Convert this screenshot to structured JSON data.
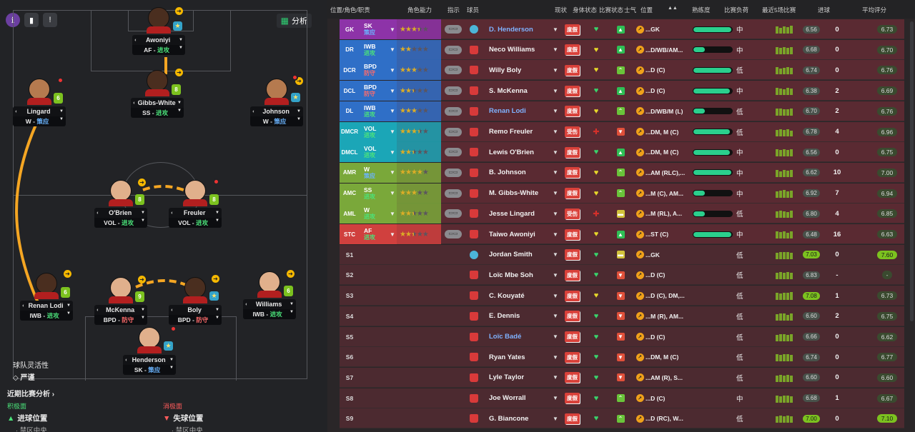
{
  "pitch": {
    "analyse_label": "分析",
    "team_mentality_label": "球队灵活性",
    "team_mentality_value": "严谨",
    "recent_analysis_label": "近期比赛分析 ›",
    "positive_title": "积极面",
    "positive_main": "进球位置",
    "positive_sub": "· 禁区中央",
    "negative_title": "消极面",
    "negative_main": "失球位置",
    "negative_sub": "· 禁区中央",
    "players": [
      {
        "name": "Awoniyi",
        "role": "AF",
        "duty": "进攻",
        "duty_type": "attack",
        "badge": "star",
        "badge_text": "★"
      },
      {
        "name": "Lingard",
        "role": "W",
        "duty": "策应",
        "duty_type": "support",
        "badge": "num",
        "badge_text": "6"
      },
      {
        "name": "Gibbs-White",
        "role": "SS",
        "duty": "进攻",
        "duty_type": "attack",
        "badge": "num",
        "badge_text": "8"
      },
      {
        "name": "Johnson",
        "role": "W",
        "duty": "策应",
        "duty_type": "support",
        "badge": "star",
        "badge_text": "★"
      },
      {
        "name": "O'Brien",
        "role": "VOL",
        "duty": "进攻",
        "duty_type": "attack",
        "badge": "num",
        "badge_text": "8"
      },
      {
        "name": "Freuler",
        "role": "VOL",
        "duty": "进攻",
        "duty_type": "attack",
        "badge": "num",
        "badge_text": "8"
      },
      {
        "name": "Renan Lodi",
        "role": "IWB",
        "duty": "进攻",
        "duty_type": "attack",
        "badge": "num",
        "badge_text": "6"
      },
      {
        "name": "McKenna",
        "role": "BPD",
        "duty": "防守",
        "duty_type": "defend",
        "badge": "num",
        "badge_text": "9"
      },
      {
        "name": "Boly",
        "role": "BPD",
        "duty": "防守",
        "duty_type": "defend",
        "badge": "star",
        "badge_text": "★"
      },
      {
        "name": "Williams",
        "role": "IWB",
        "duty": "进攻",
        "duty_type": "attack",
        "badge": "num",
        "badge_text": "6"
      },
      {
        "name": "Henderson",
        "role": "SK",
        "duty": "策应",
        "duty_type": "support",
        "badge": "star",
        "badge_text": "★"
      }
    ]
  },
  "table": {
    "headers": {
      "position_role": "位置/角色/职责",
      "role_ability": "角色能力",
      "instructions": "指示",
      "player": "球员",
      "status": "现状",
      "condition": "身体状态",
      "match_sharpness": "比赛状态",
      "morale": "士气",
      "position": "位置",
      "sort": "▲▲",
      "familiarity": "熟练度",
      "match_load": "比赛负荷",
      "last5": "最近5场比赛",
      "goals": "进球",
      "avg_rating": "平均评分"
    },
    "rows": [
      {
        "pos": "GK",
        "pos_color": "#8d33a8",
        "role": "SK",
        "duty": "策应",
        "duty_type": "support",
        "stars": 3.5,
        "gk": true,
        "name": "D. Henderson",
        "link": true,
        "status": "度假",
        "cond": "heart",
        "sharp": "up",
        "sharp_color": "#2fbf55",
        "position": "...GK",
        "fam": 0.98,
        "load": "中",
        "form": [
          10,
          8,
          10,
          9,
          11
        ],
        "avg": "6.56",
        "avg_hi": false,
        "goals": "0",
        "rating": "6.73",
        "rating_hi": false
      },
      {
        "pos": "DR",
        "pos_color": "#2f6fc7",
        "role": "IWB",
        "duty": "进攻",
        "duty_type": "attack",
        "stars": 2,
        "gk": false,
        "name": "Neco Williams",
        "link": false,
        "status": "度假",
        "cond": "yellow",
        "sharp": "up",
        "sharp_color": "#2fbf55",
        "position": "...D/WB/AM...",
        "fam": 0.3,
        "load": "中",
        "form": [
          10,
          9,
          10,
          9,
          10
        ],
        "avg": "6.68",
        "avg_hi": false,
        "goals": "0",
        "rating": "6.70",
        "rating_hi": false
      },
      {
        "pos": "DCR",
        "pos_color": "#2f6fc7",
        "role": "BPD",
        "duty": "防守",
        "duty_type": "defend",
        "stars": 3,
        "gk": false,
        "name": "Willy Boly",
        "link": false,
        "status": "度假",
        "cond": "yellow",
        "sharp": "up2",
        "sharp_color": "#6ac43a",
        "position": "...D (C)",
        "fam": 0.98,
        "load": "低",
        "form": [
          10,
          8,
          9,
          10,
          9
        ],
        "avg": "6.74",
        "avg_hi": false,
        "goals": "0",
        "rating": "6.76",
        "rating_hi": false
      },
      {
        "pos": "DCL",
        "pos_color": "#2f6fc7",
        "role": "BPD",
        "duty": "防守",
        "duty_type": "defend",
        "stars": 2.5,
        "gk": false,
        "name": "S. McKenna",
        "link": false,
        "status": "度假",
        "cond": "heart",
        "sharp": "up",
        "sharp_color": "#2fbf55",
        "position": "...D (C)",
        "fam": 0.95,
        "load": "中",
        "form": [
          10,
          9,
          8,
          10,
          9
        ],
        "avg": "6.38",
        "avg_hi": false,
        "goals": "2",
        "rating": "6.69",
        "rating_hi": false
      },
      {
        "pos": "DL",
        "pos_color": "#2f6fc7",
        "role": "IWB",
        "duty": "进攻",
        "duty_type": "attack",
        "stars": 3,
        "gk": false,
        "name": "Renan Lodi",
        "link": true,
        "status": "度假",
        "cond": "yellow",
        "sharp": "up2",
        "sharp_color": "#6ac43a",
        "position": "...D/WB/M (L)",
        "fam": 0.3,
        "load": "低",
        "form": [
          10,
          10,
          9,
          9,
          10
        ],
        "avg": "6.70",
        "avg_hi": false,
        "goals": "2",
        "rating": "6.76",
        "rating_hi": false
      },
      {
        "pos": "DMCR",
        "pos_color": "#1ba6b7",
        "role": "VOL",
        "duty": "进攻",
        "duty_type": "attack",
        "stars": 3.5,
        "gk": false,
        "name": "Remo Freuler",
        "link": false,
        "status": "受伤",
        "cond": "injury",
        "sharp": "down",
        "sharp_color": "#e0503a",
        "position": "...DM, M (C)",
        "fam": 0.95,
        "load": "低",
        "form": [
          9,
          10,
          9,
          10,
          8
        ],
        "avg": "6.78",
        "avg_hi": false,
        "goals": "4",
        "rating": "6.96",
        "rating_hi": false
      },
      {
        "pos": "DMCL",
        "pos_color": "#1ba6b7",
        "role": "VOL",
        "duty": "进攻",
        "duty_type": "attack",
        "stars": 2.5,
        "gk": false,
        "name": "Lewis O'Brien",
        "link": false,
        "status": "度假",
        "cond": "heart",
        "sharp": "up",
        "sharp_color": "#2fbf55",
        "position": "...DM, M (C)",
        "fam": 0.95,
        "load": "中",
        "form": [
          10,
          9,
          10,
          9,
          10
        ],
        "avg": "6.56",
        "avg_hi": false,
        "goals": "0",
        "rating": "6.75",
        "rating_hi": false
      },
      {
        "pos": "AMR",
        "pos_color": "#7aa83a",
        "role": "W",
        "duty": "策应",
        "duty_type": "support",
        "stars": 4,
        "gk": false,
        "name": "B. Johnson",
        "link": false,
        "status": "度假",
        "cond": "yellow",
        "sharp": "up2",
        "sharp_color": "#6ac43a",
        "position": "...AM (RLC),...",
        "fam": 0.98,
        "load": "中",
        "form": [
          10,
          8,
          10,
          9,
          10
        ],
        "avg": "6.62",
        "avg_hi": false,
        "goals": "10",
        "rating": "7.00",
        "rating_hi": false
      },
      {
        "pos": "AMC",
        "pos_color": "#7aa83a",
        "role": "SS",
        "duty": "进攻",
        "duty_type": "attack",
        "stars": 3,
        "gk": false,
        "name": "M. Gibbs-White",
        "link": false,
        "status": "度假",
        "cond": "yellow",
        "sharp": "up2",
        "sharp_color": "#6ac43a",
        "position": "...M (C), AM...",
        "fam": 0.3,
        "load": "中",
        "form": [
          9,
          10,
          11,
          9,
          10
        ],
        "avg": "6.92",
        "avg_hi": false,
        "goals": "7",
        "rating": "6.94",
        "rating_hi": false
      },
      {
        "pos": "AML",
        "pos_color": "#7aa83a",
        "role": "W",
        "duty": "进攻",
        "duty_type": "attack",
        "stars": 2.5,
        "gk": false,
        "name": "Jesse Lingard",
        "link": false,
        "status": "受伤",
        "cond": "injury",
        "sharp": "flat",
        "sharp_color": "#d2c23a",
        "position": "...M (RL), A...",
        "fam": 0.3,
        "load": "低",
        "form": [
          9,
          10,
          9,
          8,
          10
        ],
        "avg": "6.80",
        "avg_hi": false,
        "goals": "4",
        "rating": "6.85",
        "rating_hi": false
      },
      {
        "pos": "STC",
        "pos_color": "#d0403e",
        "role": "AF",
        "duty": "进攻",
        "duty_type": "attack",
        "stars": 2.5,
        "gk": false,
        "name": "Taiwo Awoniyi",
        "link": false,
        "status": "度假",
        "cond": "yellow",
        "sharp": "up",
        "sharp_color": "#2fbf55",
        "position": "...ST (C)",
        "fam": 0.98,
        "load": "中",
        "form": [
          10,
          9,
          10,
          8,
          10
        ],
        "avg": "6.48",
        "avg_hi": false,
        "goals": "16",
        "rating": "6.63",
        "rating_hi": false
      },
      {
        "pos": "S1",
        "role": "",
        "duty": "",
        "stars": 0,
        "gk": true,
        "name": "Jordan Smith",
        "link": false,
        "status": "度假",
        "cond": "heart",
        "sharp": "flat",
        "sharp_color": "#d2c23a",
        "position": "...GK",
        "fam": null,
        "load": "低",
        "form": [
          9,
          10,
          10,
          10,
          9
        ],
        "avg": "7.03",
        "avg_hi": true,
        "goals": "0",
        "rating": "7.60",
        "rating_hi": true
      },
      {
        "pos": "S2",
        "role": "",
        "duty": "",
        "stars": 0,
        "gk": false,
        "name": "Loïc Mbe Soh",
        "link": false,
        "status": "度假",
        "cond": "heart",
        "sharp": "down",
        "sharp_color": "#e0503a",
        "position": "...D (C)",
        "fam": null,
        "load": "低",
        "form": [
          9,
          10,
          9,
          10,
          9
        ],
        "avg": "6.83",
        "avg_hi": false,
        "goals": "-",
        "rating": "-",
        "rating_hi": false
      },
      {
        "pos": "S3",
        "role": "",
        "duty": "",
        "stars": 0,
        "gk": false,
        "name": "C. Kouyaté",
        "link": false,
        "status": "度假",
        "cond": "yellow",
        "sharp": "down",
        "sharp_color": "#e0503a",
        "position": "...D (C), DM,...",
        "fam": null,
        "load": "低",
        "form": [
          10,
          9,
          10,
          10,
          11
        ],
        "avg": "7.08",
        "avg_hi": true,
        "goals": "1",
        "rating": "6.73",
        "rating_hi": false
      },
      {
        "pos": "S4",
        "role": "",
        "duty": "",
        "stars": 0,
        "gk": false,
        "name": "E. Dennis",
        "link": false,
        "status": "度假",
        "cond": "heart",
        "sharp": "down",
        "sharp_color": "#e0503a",
        "position": "...M (R), AM...",
        "fam": null,
        "load": "低",
        "form": [
          9,
          10,
          10,
          8,
          10
        ],
        "avg": "6.60",
        "avg_hi": false,
        "goals": "2",
        "rating": "6.75",
        "rating_hi": false
      },
      {
        "pos": "S5",
        "role": "",
        "duty": "",
        "stars": 0,
        "gk": false,
        "name": "Loïc Badé",
        "link": true,
        "status": "度假",
        "cond": "heart",
        "sharp": "down",
        "sharp_color": "#e0503a",
        "position": "...D (C)",
        "fam": null,
        "load": "低",
        "form": [
          9,
          10,
          10,
          9,
          10
        ],
        "avg": "6.66",
        "avg_hi": false,
        "goals": "0",
        "rating": "6.62",
        "rating_hi": false
      },
      {
        "pos": "S6",
        "role": "",
        "duty": "",
        "stars": 0,
        "gk": false,
        "name": "Ryan Yates",
        "link": false,
        "status": "度假",
        "cond": "heart",
        "sharp": "down",
        "sharp_color": "#e0503a",
        "position": "...DM, M (C)",
        "fam": null,
        "load": "低",
        "form": [
          10,
          9,
          10,
          10,
          9
        ],
        "avg": "6.74",
        "avg_hi": false,
        "goals": "0",
        "rating": "6.77",
        "rating_hi": false
      },
      {
        "pos": "S7",
        "role": "",
        "duty": "",
        "stars": 0,
        "gk": false,
        "name": "Lyle Taylor",
        "link": false,
        "status": "度假",
        "cond": "heart",
        "sharp": "down",
        "sharp_color": "#e0503a",
        "position": "...AM (R), S...",
        "fam": null,
        "load": "低",
        "form": [
          9,
          10,
          9,
          10,
          9
        ],
        "avg": "6.60",
        "avg_hi": false,
        "goals": "0",
        "rating": "6.60",
        "rating_hi": false
      },
      {
        "pos": "S8",
        "role": "",
        "duty": "",
        "stars": 0,
        "gk": false,
        "name": "Joe Worrall",
        "link": false,
        "status": "度假",
        "cond": "heart",
        "sharp": "up2",
        "sharp_color": "#6ac43a",
        "position": "...D (C)",
        "fam": null,
        "load": "中",
        "form": [
          10,
          9,
          10,
          10,
          9
        ],
        "avg": "6.68",
        "avg_hi": false,
        "goals": "1",
        "rating": "6.67",
        "rating_hi": false
      },
      {
        "pos": "S9",
        "role": "",
        "duty": "",
        "stars": 0,
        "gk": false,
        "name": "G. Biancone",
        "link": false,
        "status": "度假",
        "cond": "heart",
        "sharp": "up2",
        "sharp_color": "#6ac43a",
        "position": "...D (RC), W...",
        "fam": null,
        "load": "低",
        "form": [
          9,
          10,
          9,
          10,
          9
        ],
        "avg": "7.00",
        "avg_hi": true,
        "goals": "0",
        "rating": "7.10",
        "rating_hi": true
      }
    ]
  }
}
